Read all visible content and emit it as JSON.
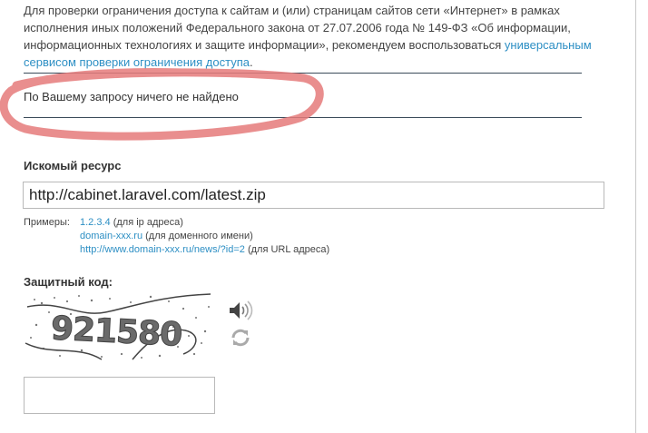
{
  "intro": {
    "text": "Для проверки ограничения доступа к сайтам и (или) страницам сайтов сети «Интернет» в рамках исполнения иных положений Федерального закона от 27.07.2006 года № 149-ФЗ «Об информации, информационных технологиях и защите информации», рекомендуем воспользоваться ",
    "link_text": "универсальным сервисом проверки ограничения доступа",
    "tail": "."
  },
  "result": {
    "message": "По Вашему запросу ничего не найдено"
  },
  "resource": {
    "label": "Искомый ресурс",
    "value": "http://cabinet.laravel.com/latest.zip"
  },
  "examples": {
    "heading": "Примеры:",
    "items": [
      {
        "link": "1.2.3.4",
        "note": " (для ip адреса)"
      },
      {
        "link": "domain-xxx.ru",
        "note": " (для доменного имени)"
      },
      {
        "link": "http://www.domain-xxx.ru/news/?id=2",
        "note": " (для URL адреса)"
      }
    ]
  },
  "captcha": {
    "label": "Защитный код:",
    "code_text": "921580",
    "audio_icon": "speaker-icon",
    "refresh_icon": "refresh-icon",
    "input_value": ""
  },
  "colors": {
    "link": "#2d8fc4",
    "highlight_ring": "#e57a7a",
    "rule": "#3b4b5a"
  }
}
